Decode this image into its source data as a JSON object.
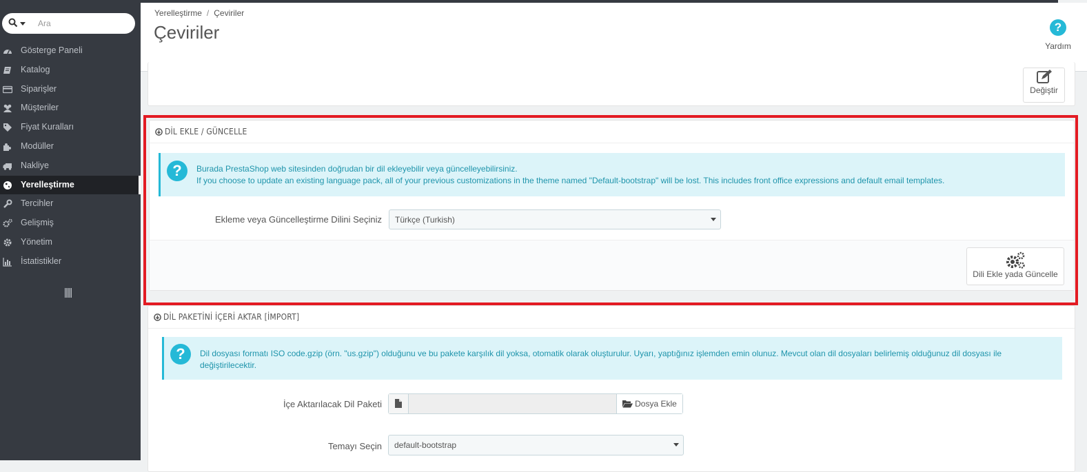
{
  "search": {
    "placeholder": "Ara"
  },
  "sidebar": {
    "items": [
      {
        "label": "Gösterge Paneli",
        "icon": "dashboard-icon"
      },
      {
        "label": "Katalog",
        "icon": "book-icon"
      },
      {
        "label": "Siparişler",
        "icon": "credit-card-icon"
      },
      {
        "label": "Müşteriler",
        "icon": "users-icon"
      },
      {
        "label": "Fiyat Kuralları",
        "icon": "tags-icon"
      },
      {
        "label": "Modüller",
        "icon": "puzzle-icon"
      },
      {
        "label": "Nakliye",
        "icon": "truck-icon"
      },
      {
        "label": "Yerelleştirme",
        "icon": "globe-icon",
        "active": true
      },
      {
        "label": "Tercihler",
        "icon": "wrench-icon"
      },
      {
        "label": "Gelişmiş",
        "icon": "cogs-icon"
      },
      {
        "label": "Yönetim",
        "icon": "cog-icon"
      },
      {
        "label": "İstatistikler",
        "icon": "bar-chart-icon"
      }
    ]
  },
  "header": {
    "breadcrumb": [
      "Yerelleştirme",
      "Çeviriler"
    ],
    "breadcrumb_sep": "/",
    "title": "Çeviriler",
    "help_label": "Yardım"
  },
  "top_panel": {
    "edit_label": "Değiştir"
  },
  "add_panel": {
    "heading": "DİL EKLE / GÜNCELLE",
    "alert_line1": "Burada PrestaShop web sitesinden doğrudan bir dil ekleyebilir veya güncelleyebilirsiniz.",
    "alert_line2": "If you choose to update an existing language pack, all of your previous customizations in the theme named \"Default-bootstrap\" will be lost. This includes front office expressions and default email templates.",
    "select_label": "Ekleme veya Güncelleştirme Dilini Seçiniz",
    "select_value": "Türkçe (Turkish)",
    "button_label": "Dili Ekle yada Güncelle"
  },
  "import_panel": {
    "heading": "DİL PAKETİNİ İÇERİ AKTAR [İMPORT]",
    "alert_text": "Dil dosyası formatı ISO code.gzip (örn. \"us.gzip\") olduğunu ve bu pakete karşılık dil yoksa, otomatik olarak oluşturulur. Uyarı, yaptığınız işlemden emin olunuz. Mevcut olan dil dosyaları belirlemiş olduğunuz dil dosyası ile değiştirilecektir.",
    "file_label": "İçe Aktarılacak Dil Paketi",
    "file_button": "Dosya Ekle",
    "theme_label": "Temayı Seçin",
    "theme_value": "default-bootstrap"
  },
  "colors": {
    "accent": "#25b9d7",
    "highlight": "#e31b23",
    "sidebar": "#363a41"
  }
}
